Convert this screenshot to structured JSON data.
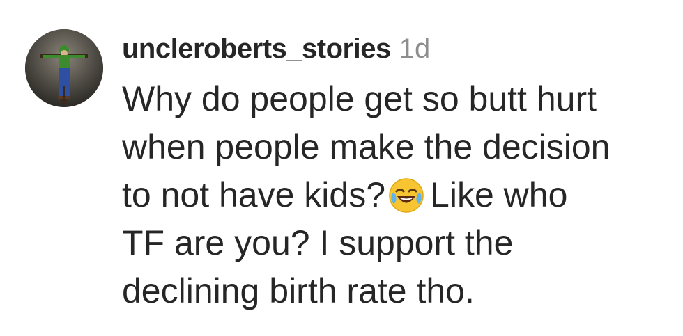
{
  "comment": {
    "username": "uncleroberts_stories",
    "timestamp": "1d",
    "lines": [
      "Why do people get so butt hurt",
      "when people make the decision",
      "to not have kids?",
      "Like who",
      "TF are you? I support the",
      "declining birth rate tho."
    ],
    "emoji": "face-with-tears-of-joy-icon"
  }
}
